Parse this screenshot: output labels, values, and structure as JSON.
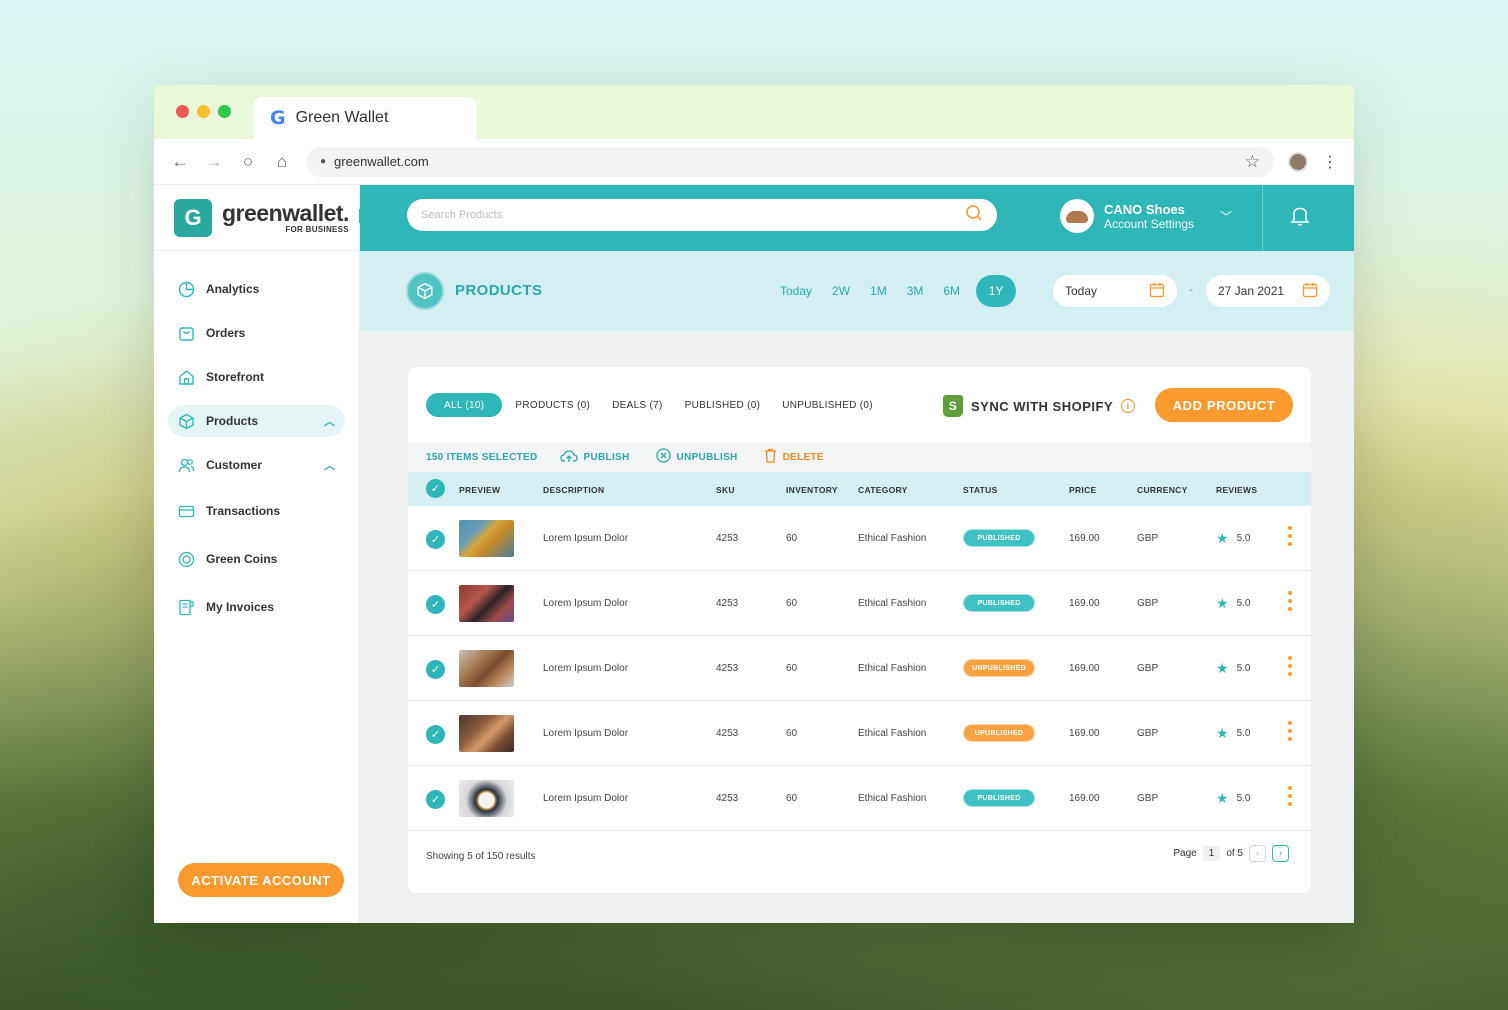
{
  "browser": {
    "tab_title": "Green Wallet",
    "url": "greenwallet.com"
  },
  "brand": {
    "name": "greenwallet.",
    "sub": "FOR BUSINESS",
    "mark": "G"
  },
  "sidebar": {
    "items": [
      {
        "label": "Analytics",
        "icon": "pie-chart-icon"
      },
      {
        "label": "Orders",
        "icon": "shopping-bag-icon"
      },
      {
        "label": "Storefront",
        "icon": "store-icon"
      },
      {
        "label": "Products",
        "icon": "box-icon",
        "active": true
      },
      {
        "label": "Customer",
        "icon": "users-icon"
      },
      {
        "label": "Transactions",
        "icon": "card-icon"
      },
      {
        "label": "Green Coins",
        "icon": "coin-icon"
      },
      {
        "label": "My Invoices",
        "icon": "invoice-icon"
      }
    ],
    "activate_label": "ACTIVATE ACCOUNT"
  },
  "search": {
    "placeholder": "Search Products"
  },
  "account": {
    "name": "CANO Shoes",
    "sub": "Account Settings"
  },
  "page": {
    "title": "PRODUCTS",
    "ranges": [
      "Today",
      "2W",
      "1M",
      "3M",
      "6M",
      "1Y"
    ],
    "selected_range": "1Y",
    "date_from": "Today",
    "date_separator": "-",
    "date_to": "27 Jan 2021"
  },
  "filters": {
    "all": "ALL (10)",
    "products": "PRODUCTS (0)",
    "deals": "DEALS (7)",
    "published": "PUBLISHED (0)",
    "unpublished": "UNPUBLISHED (0)"
  },
  "shopify_label": "SYNC WITH SHOPIFY",
  "add_product_label": "ADD PRODUCT",
  "bulk": {
    "selected": "150 ITEMS SELECTED",
    "publish": "PUBLISH",
    "unpublish": "UNPUBLISH",
    "delete": "DELETE"
  },
  "table": {
    "headers": {
      "preview": "PREVIEW",
      "description": "DESCRIPTION",
      "sku": "SKU",
      "inventory": "INVENTORY",
      "category": "CATEGORY",
      "status": "STATUS",
      "price": "PRICE",
      "currency": "CURRENCY",
      "reviews": "REVIEWS"
    },
    "rows": [
      {
        "description": "Lorem Ipsum Dolor",
        "sku": "4253",
        "inventory": "60",
        "category": "Ethical Fashion",
        "status": "PUBLISHED",
        "price": "169.00",
        "currency": "GBP",
        "rating": "5.0"
      },
      {
        "description": "Lorem Ipsum Dolor",
        "sku": "4253",
        "inventory": "60",
        "category": "Ethical Fashion",
        "status": "PUBLISHED",
        "price": "169.00",
        "currency": "GBP",
        "rating": "5.0"
      },
      {
        "description": "Lorem Ipsum Dolor",
        "sku": "4253",
        "inventory": "60",
        "category": "Ethical Fashion",
        "status": "UNPUBLISHED",
        "price": "169.00",
        "currency": "GBP",
        "rating": "5.0"
      },
      {
        "description": "Lorem Ipsum Dolor",
        "sku": "4253",
        "inventory": "60",
        "category": "Ethical Fashion",
        "status": "UPUBLISHED",
        "price": "169.00",
        "currency": "GBP",
        "rating": "5.0"
      },
      {
        "description": "Lorem Ipsum Dolor",
        "sku": "4253",
        "inventory": "60",
        "category": "Ethical Fashion",
        "status": "PUBLISHED",
        "price": "169.00",
        "currency": "GBP",
        "rating": "5.0"
      }
    ]
  },
  "footer": {
    "showing": "Showing 5 of 150 results",
    "page_label": "Page",
    "page_current": "1",
    "page_of": "of 5"
  },
  "colors": {
    "primary": "#2fb6b8",
    "accent": "#f99a2e",
    "light": "#d3eff2"
  }
}
